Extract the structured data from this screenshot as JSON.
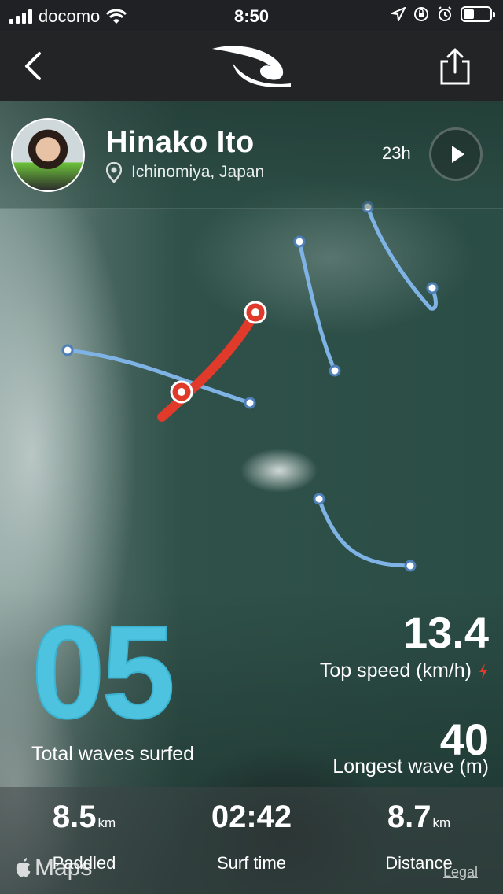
{
  "status_bar": {
    "carrier": "docomo",
    "time": "8:50",
    "battery_level": 0.4
  },
  "profile": {
    "name": "Hinako Ito",
    "location": "Ichinomiya, Japan",
    "time_ago": "23h"
  },
  "stats": {
    "total_waves": "05",
    "total_waves_label": "Total waves surfed",
    "top_speed": "13.4",
    "top_speed_label": "Top speed (km/h)",
    "longest_wave": "40",
    "longest_wave_label": "Longest wave (m)"
  },
  "summary": [
    {
      "value": "8.5",
      "unit": "km",
      "label": "Paddled"
    },
    {
      "value": "02:42",
      "unit": "",
      "label": "Surf time"
    },
    {
      "value": "8.7",
      "unit": "km",
      "label": "Distance"
    }
  ],
  "map": {
    "brand": "Maps",
    "legal": "Legal"
  },
  "colors": {
    "accent_blue": "#4ec3e0",
    "track_blue": "#7fb3e6",
    "highlight_red": "#e03a2a"
  },
  "icons": [
    "back-chevron-icon",
    "ripcurl-logo",
    "share-icon",
    "location-pin-icon",
    "play-icon",
    "lightning-icon",
    "apple-icon"
  ]
}
